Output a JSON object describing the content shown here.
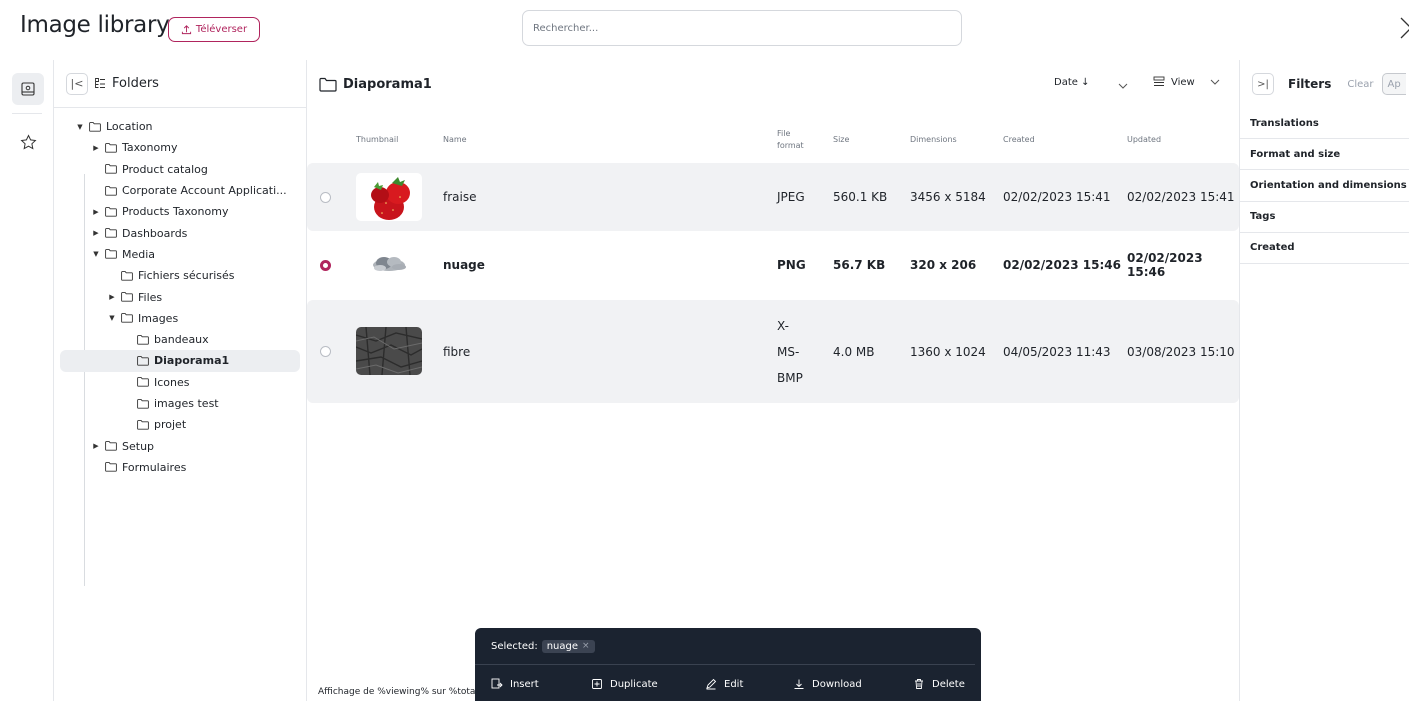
{
  "header": {
    "title": "Image library",
    "upload_label": "Téléverser",
    "search_placeholder": "Rechercher..."
  },
  "tree": {
    "title": "Folders",
    "nodes": [
      {
        "label": "Location",
        "depth": 0,
        "caret": "down"
      },
      {
        "label": "Taxonomy",
        "depth": 1,
        "caret": "right"
      },
      {
        "label": "Product catalog",
        "depth": 1,
        "caret": ""
      },
      {
        "label": "Corporate Account Applicati...",
        "depth": 1,
        "caret": ""
      },
      {
        "label": "Products Taxonomy",
        "depth": 1,
        "caret": "right"
      },
      {
        "label": "Dashboards",
        "depth": 1,
        "caret": "right"
      },
      {
        "label": "Media",
        "depth": 1,
        "caret": "down"
      },
      {
        "label": "Fichiers sécurisés",
        "depth": 2,
        "caret": ""
      },
      {
        "label": "Files",
        "depth": 2,
        "caret": "right"
      },
      {
        "label": "Images",
        "depth": 2,
        "caret": "down"
      },
      {
        "label": "bandeaux",
        "depth": 3,
        "caret": ""
      },
      {
        "label": "Diaporama1",
        "depth": 3,
        "caret": "",
        "selected": true
      },
      {
        "label": "Icones",
        "depth": 3,
        "caret": ""
      },
      {
        "label": "images test",
        "depth": 3,
        "caret": ""
      },
      {
        "label": "projet",
        "depth": 3,
        "caret": ""
      },
      {
        "label": "Setup",
        "depth": 1,
        "caret": "right"
      },
      {
        "label": "Formulaires",
        "depth": 1,
        "caret": ""
      }
    ]
  },
  "main": {
    "folder_title": "Diaporama1",
    "sort_label": "Date ↓",
    "view_label": "View",
    "columns": {
      "thumbnail": "Thumbnail",
      "name": "Name",
      "format_line1": "File",
      "format_line2": "format",
      "size": "Size",
      "dimensions": "Dimensions",
      "created": "Created",
      "updated": "Updated"
    },
    "rows": [
      {
        "name": "fraise",
        "format": "JPEG",
        "size": "560.1 KB",
        "dimensions": "3456 x 5184",
        "created": "02/02/2023 15:41",
        "updated": "02/02/2023 15:41",
        "selected": false,
        "thumb": "strawberry-thumbnail"
      },
      {
        "name": "nuage",
        "format": "PNG",
        "size": "56.7 KB",
        "dimensions": "320 x 206",
        "created": "02/02/2023 15:46",
        "updated": "02/02/2023 15:46",
        "selected": true,
        "thumb": "cloud-thumbnail"
      },
      {
        "name": "fibre",
        "format_lines": [
          "X-",
          "MS-",
          "BMP"
        ],
        "size": "4.0 MB",
        "dimensions": "1360 x 1024",
        "created": "04/05/2023 11:43",
        "updated": "03/08/2023 15:10",
        "selected": false,
        "thumb": "fiber-texture-thumbnail"
      }
    ],
    "footer_text": "Affichage de %viewing% sur %total%"
  },
  "selection_bar": {
    "selected_label": "Selected:",
    "chip": "nuage",
    "chip_close": "×",
    "actions": {
      "insert": "Insert",
      "duplicate": "Duplicate",
      "edit": "Edit",
      "download": "Download",
      "delete": "Delete"
    }
  },
  "filters": {
    "title": "Filters",
    "clear": "Clear",
    "apply": "Ap",
    "items": [
      "Translations",
      "Format and size",
      "Orientation and dimensions",
      "Tags",
      "Created"
    ]
  },
  "colors": {
    "accent": "#b0245d",
    "selection_bar_bg": "#1b2330",
    "row_alt_bg": "#f1f2f4"
  }
}
